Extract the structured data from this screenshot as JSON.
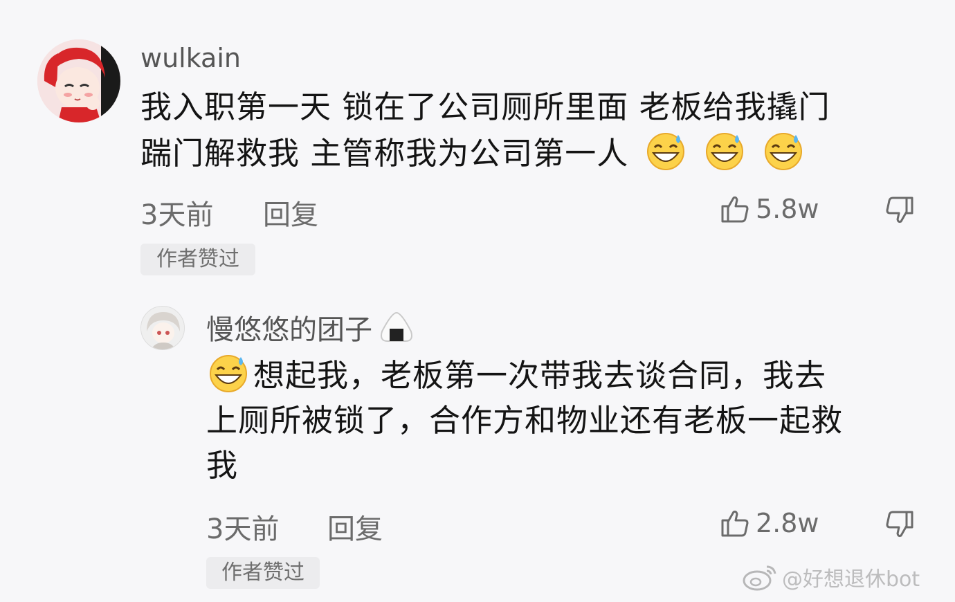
{
  "comments": [
    {
      "username": "wulkain",
      "text_line1": "我入职第一天 锁在了公司厕所里面 老板给我撬门",
      "text_line2": "踹门解救我 主管称我为公司第一人",
      "time": "3天前",
      "reply_label": "回复",
      "likes": "5.8w",
      "badge": "作者赞过",
      "avatar_icon": "cartoon-girl-avatar",
      "emoji_icon": "laughing-sweat-emoji"
    },
    {
      "username": "慢悠悠的团子",
      "username_emoji": "onigiri-emoji",
      "text_line1": "想起我，老板第一次带我去谈合同，我去",
      "text_line2": "上厕所被锁了，合作方和物业还有老板一起救",
      "text_line3": "我",
      "time": "3天前",
      "reply_label": "回复",
      "likes": "2.8w",
      "badge": "作者赞过",
      "avatar_icon": "anime-boy-avatar",
      "emoji_icon": "laughing-sweat-emoji"
    }
  ],
  "watermark": {
    "text": "@好想退休bot",
    "icon": "weibo-logo-icon"
  },
  "colors": {
    "background": "#f7f7f9",
    "text": "#141414",
    "meta": "#6b6b6b",
    "badge_bg": "#ececee"
  }
}
